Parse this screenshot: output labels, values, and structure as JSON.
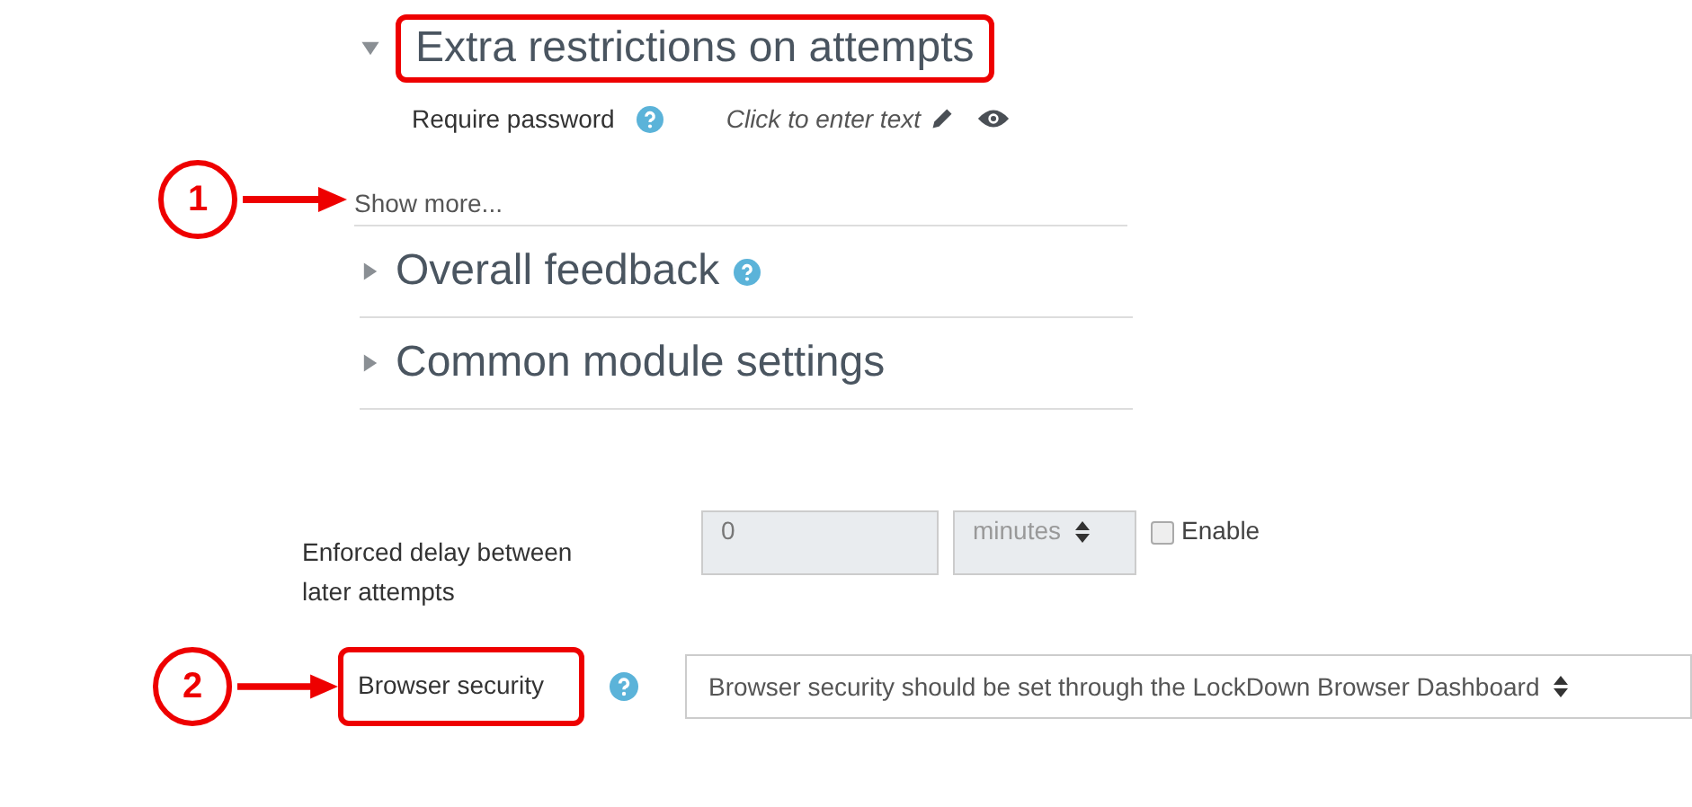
{
  "callouts": [
    {
      "number": "1"
    },
    {
      "number": "2"
    }
  ],
  "sections": [
    {
      "title": "Extra restrictions on attempts",
      "expanded": true,
      "highlighted": true,
      "help": false
    },
    {
      "title": "Overall feedback",
      "expanded": false,
      "highlighted": false,
      "help": true
    },
    {
      "title": "Common module settings",
      "expanded": false,
      "highlighted": false,
      "help": false
    }
  ],
  "password": {
    "label": "Require password",
    "value": "Click to enter text"
  },
  "show_more": "Show more...",
  "delay": {
    "label": "Enforced delay between later attempts",
    "value": "0",
    "unit": "minutes",
    "checkbox_label": "Enable",
    "checked": false
  },
  "browser_security": {
    "label": "Browser security",
    "highlighted": true,
    "value": "Browser security should be set through the LockDown Browser Dashboard"
  }
}
